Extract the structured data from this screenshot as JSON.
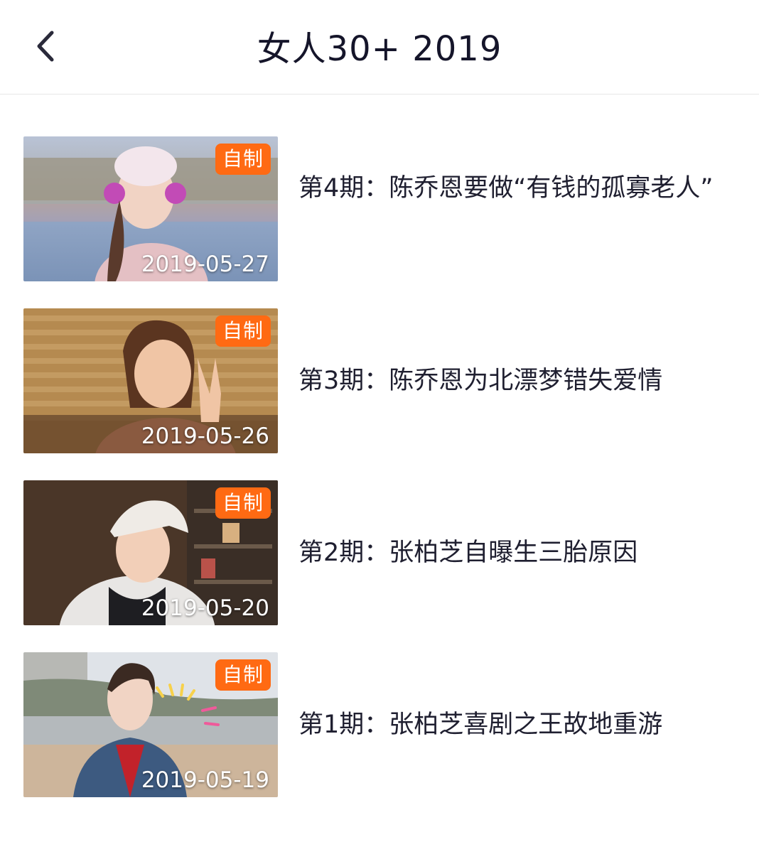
{
  "header": {
    "title": "女人30+  2019",
    "back_icon": "chevron-left-icon"
  },
  "colors": {
    "badge": "#ff6a13",
    "title": "#15152a"
  },
  "episodes": [
    {
      "badge": "自制",
      "date": "2019-05-27",
      "title": "第4期：陈乔恩要做“有钱的孤寡老人”"
    },
    {
      "badge": "自制",
      "date": "2019-05-26",
      "title": "第3期：陈乔恩为北漂梦错失爱情"
    },
    {
      "badge": "自制",
      "date": "2019-05-20",
      "title": "第2期：张柏芝自曝生三胎原因"
    },
    {
      "badge": "自制",
      "date": "2019-05-19",
      "title": "第1期：张柏芝喜剧之王故地重游"
    }
  ]
}
